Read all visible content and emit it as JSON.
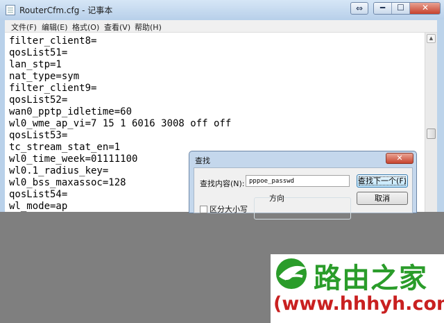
{
  "window": {
    "title": "RouterCfm.cfg - 记事本",
    "controls": {
      "restore_glyph": "⇔",
      "minimize_glyph": "━",
      "maximize_glyph": "☐",
      "close_glyph": "✕"
    }
  },
  "menu": [
    "文件(F)",
    "编辑(E)",
    "格式(O)",
    "查看(V)",
    "帮助(H)"
  ],
  "editor_lines": [
    "filter_client8=",
    "qosList51=",
    "lan_stp=1",
    "nat_type=sym",
    "filter_client9=",
    "qosList52=",
    "wan0_pptp_idletime=60",
    "wl0_wme_ap_vi=7 15 1 6016 3008 off off",
    "qosList53=",
    "tc_stream_stat_en=1",
    "wl0_time_week=01111100",
    "wl0.1_radius_key=",
    "wl0_bss_maxassoc=128",
    "qosList54=",
    "wl_mode=ap"
  ],
  "find_dialog": {
    "title": "查找",
    "find_label": "查找内容(N):",
    "find_value": "pppoe_passwd",
    "find_next_label": "查找下一个(F)",
    "cancel_label": "取消",
    "direction_label": "方向",
    "match_case_label": "区分大小写",
    "match_case_checked": false
  },
  "watermark": {
    "brand": "路由之家",
    "url": "(www.hhhyh.com)",
    "colors": {
      "green": "#2a9c2a",
      "red": "#c92020"
    }
  }
}
